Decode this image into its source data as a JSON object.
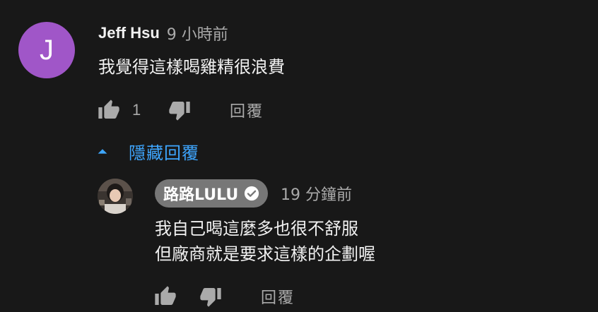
{
  "comment": {
    "avatar_letter": "J",
    "avatar_color": "#a056c8",
    "author": "Jeff Hsu",
    "timestamp": "9 小時前",
    "text": "我覺得這樣喝雞精很浪費",
    "like_count": "1",
    "reply_label": "回覆",
    "icons": [
      "thumb-up-icon",
      "thumb-down-icon"
    ]
  },
  "replies_toggle": {
    "label": "隱藏回覆",
    "icon": "caret-up-icon",
    "color": "#3ea6ff"
  },
  "reply": {
    "author": "路路LULU",
    "verified_icon": "verified-check-icon",
    "timestamp": "19 分鐘前",
    "text_lines": [
      "我自己喝這麼多也很不舒服",
      "但廠商就是要求這樣的企劃喔"
    ],
    "reply_label": "回覆",
    "icons": [
      "thumb-up-icon",
      "thumb-down-icon"
    ]
  },
  "colors": {
    "background": "#181818",
    "text_primary": "#f1f1f1",
    "text_secondary": "#aaaaaa",
    "author_chip": "#777777",
    "link": "#3ea6ff"
  }
}
